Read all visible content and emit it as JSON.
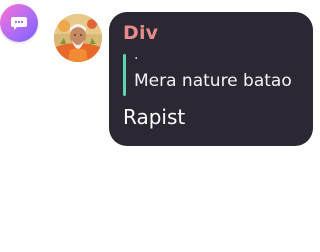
{
  "menu": {
    "icon": "chat-bubble-ellipsis-icon",
    "gradient": [
      "#ff6fd8",
      "#b06ef3",
      "#7a5cff"
    ]
  },
  "message": {
    "avatar_icon": "user-avatar-photo",
    "sender": "Div",
    "sender_color": "#e58b8b",
    "quoted_reply": {
      "marker": ".",
      "text": "Mera nature batao",
      "bar_color": "#5fd3b0"
    },
    "body": "Rapist",
    "bubble_color": "#2b2733"
  }
}
